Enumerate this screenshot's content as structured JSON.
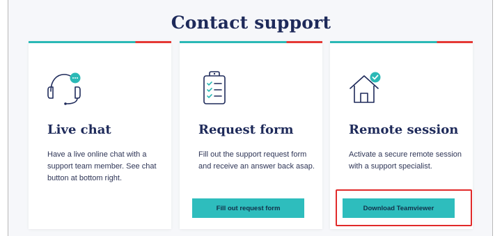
{
  "page": {
    "title": "Contact support"
  },
  "cards": [
    {
      "title": "Live chat",
      "description": "Have a live online chat with a support team member. See chat button at bottom right.",
      "icon": "headset-chat-icon"
    },
    {
      "title": "Request form",
      "description": "Fill out the support request form and receive an answer back asap.",
      "icon": "clipboard-checklist-icon",
      "button_label": "Fill out request form"
    },
    {
      "title": "Remote session",
      "description": "Activate a secure remote session with a support specialist.",
      "icon": "house-check-icon",
      "button_label": "Download Teamviewer"
    }
  ],
  "colors": {
    "accent_teal": "#2bb9b6",
    "accent_red": "#e53935",
    "heading_navy": "#1e2a5a",
    "button_teal": "#2ebdbd",
    "highlight_red": "#e12a2a"
  }
}
